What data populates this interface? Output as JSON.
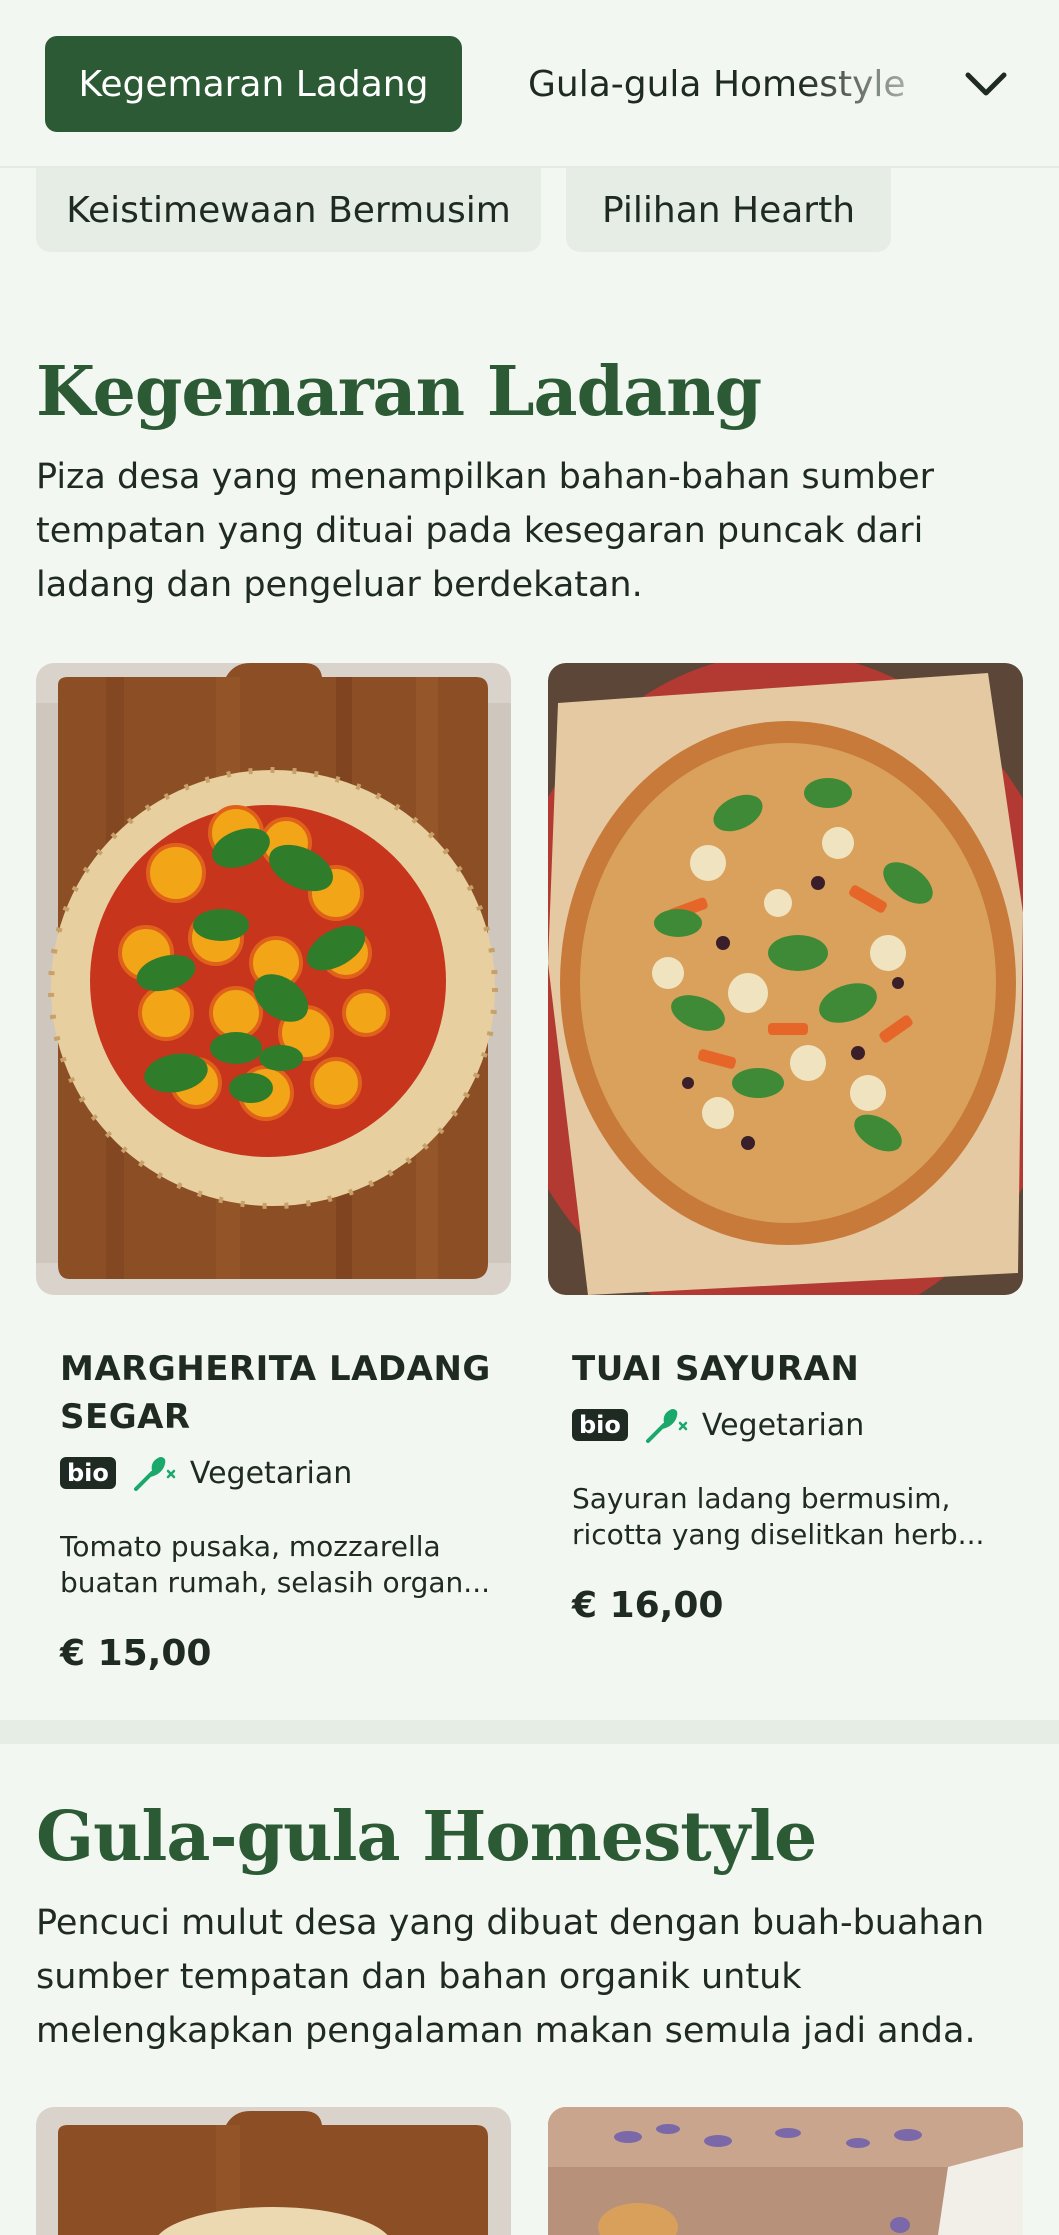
{
  "tabs": {
    "active": "Kegemaran Ladang",
    "next": "Gula-gula Homestyle",
    "row2": [
      "Keistimewaan Bermusim",
      "Pilihan Hearth"
    ]
  },
  "sections": [
    {
      "title": "Kegemaran Ladang",
      "description": "Piza desa yang menampilkan bahan-bahan sumber tempatan yang dituai pada kesegaran puncak dari ladang dan pengeluar berdekatan.",
      "items": [
        {
          "name": "MARGHERITA LADANG SEGAR",
          "badge": "bio",
          "diet": "Vegetarian",
          "description": "Tomato pusaka, mozzarella buatan rumah, selasih organ...",
          "price": "€ 15,00"
        },
        {
          "name": "TUAI SAYURAN",
          "badge": "bio",
          "diet": "Vegetarian",
          "description": "Sayuran ladang bermusim, ricotta yang diselitkan herb...",
          "price": "€ 16,00"
        }
      ]
    },
    {
      "title": "Gula-gula Homestyle",
      "description": "Pencuci mulut desa yang dibuat dengan buah-buahan sumber tempatan dan bahan organik untuk melengkapkan pengalaman makan semula jadi anda."
    }
  ],
  "colors": {
    "accent": "#2c5a35",
    "background": "#f3f7f2",
    "chip": "#e6ede5",
    "veg_icon": "#1aa86b"
  },
  "icons": [
    "chevron-down-icon",
    "vegetarian-leaf-icon"
  ]
}
